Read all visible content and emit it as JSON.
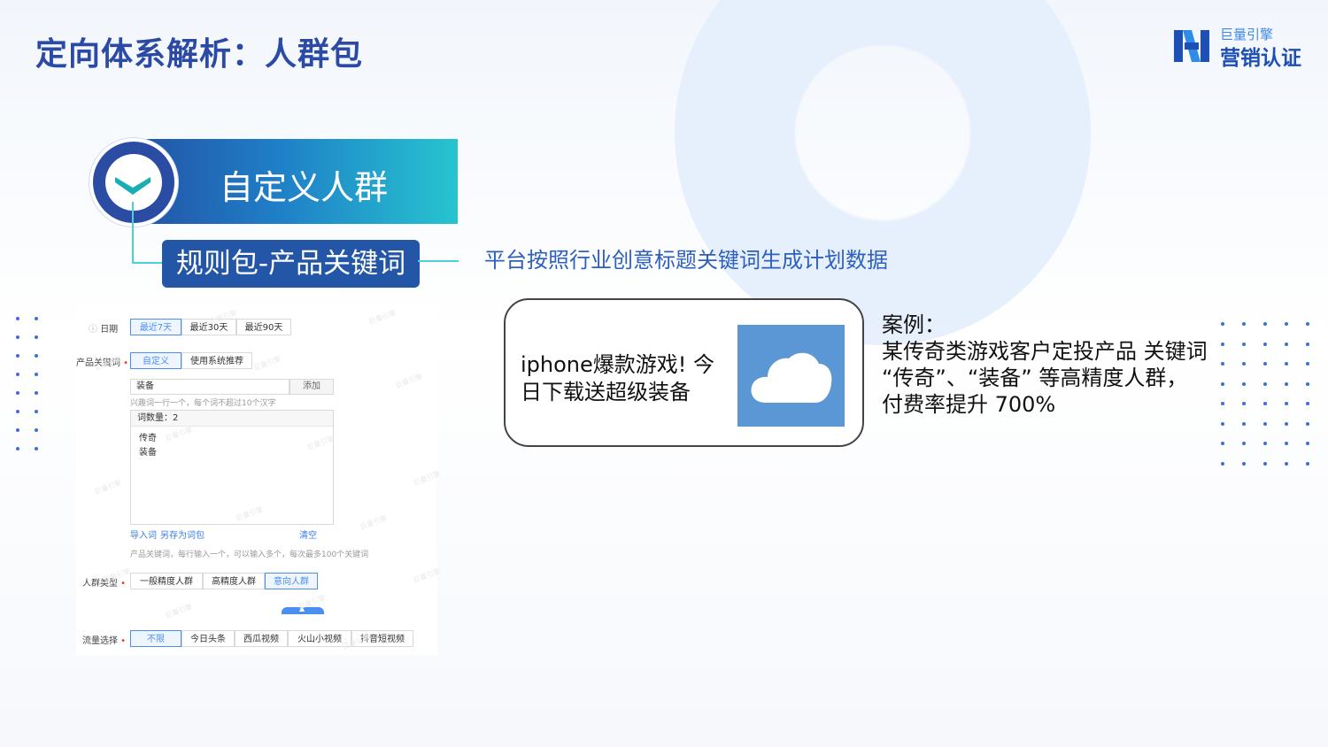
{
  "page": {
    "title": "定向体系解析：人群包",
    "logo_top": "巨量引擎",
    "logo_bottom": "营销认证"
  },
  "section": {
    "banner_label": "自定义人群",
    "rule_label": "规则包-产品关键词",
    "description": "平台按照行业创意标题关键词生成计划数据"
  },
  "panel": {
    "date_label": "日期",
    "date_options": [
      "最近7天",
      "最近30天",
      "最近90天"
    ],
    "keyword_label": "产品关键词",
    "keyword_modes": [
      "自定义",
      "使用系统推荐"
    ],
    "keyword_input_value": "装备",
    "add_button": "添加",
    "input_hint": "兴趣词一行一个，每个词不超过10个汉字",
    "word_count": "词数量：2",
    "words": [
      "传奇",
      "装备"
    ],
    "import_link": "导入词",
    "save_link": "另存为词包",
    "clear_link": "清空",
    "bottom_hint": "产品关键词，每行输入一个，可以输入多个，每次最多100个关键词",
    "crowd_label": "人群类型",
    "crowd_options": [
      "一般精度人群",
      "高精度人群",
      "意向人群"
    ],
    "traffic_label": "流量选择",
    "traffic_options": [
      "不限",
      "今日头条",
      "西瓜视频",
      "火山小视频",
      "抖音短视频"
    ],
    "watermark": "巨量引擎"
  },
  "case": {
    "ad_text": "iphone爆款游戏! 今日下载送超级装备",
    "image_icon": "cloud-icon",
    "heading": "案例：",
    "line1": "某传奇类游戏客户定投产品 关键词",
    "line2": "“传奇”、“装备” 等高精度人群，",
    "line3": "付费率提升 700%"
  },
  "colors": {
    "title_blue": "#2b4aa5",
    "banner_gradient_start": "#2352a5",
    "banner_gradient_end": "#27c4d0",
    "accent_cyan": "#4ad0d5",
    "link_blue": "#3a7ce6",
    "cloud_tile": "#5b97d5"
  }
}
